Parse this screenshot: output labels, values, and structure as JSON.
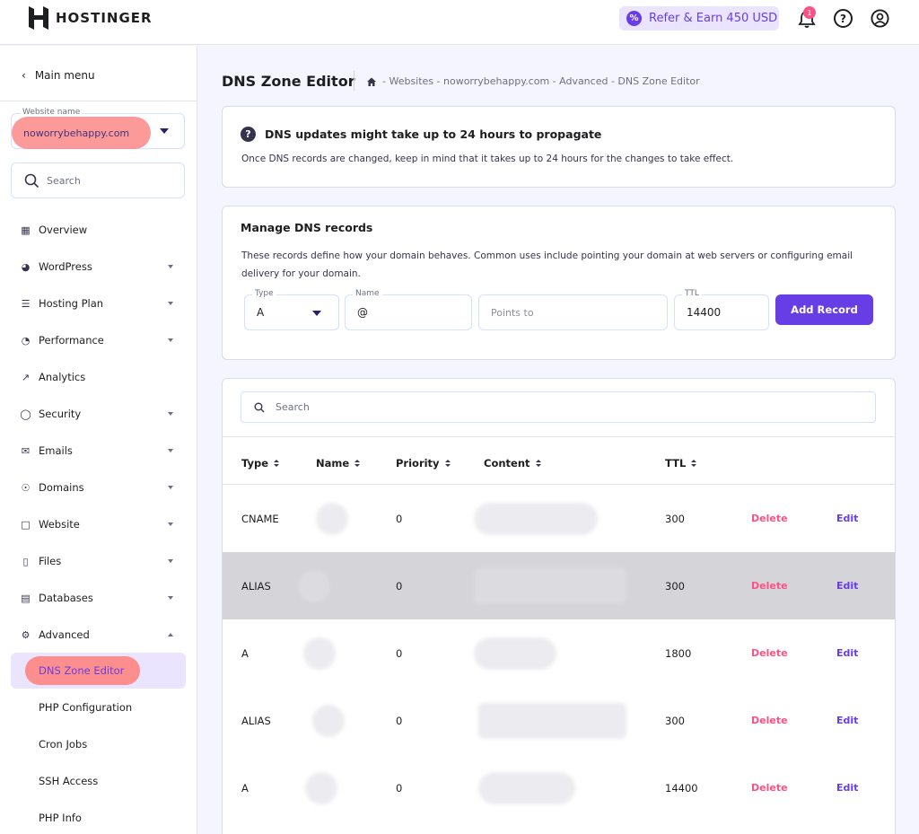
{
  "app": {
    "brand": "HOSTINGER",
    "refer_label": "Refer & Earn 450 USD",
    "notification_count": "1"
  },
  "sidebar": {
    "main_menu_label": "Main menu",
    "website_label": "Website name",
    "website_value": "noworrybehappy.com",
    "search_placeholder": "Search",
    "items": [
      {
        "label": "Overview",
        "icon": "grid-icon",
        "expandable": false
      },
      {
        "label": "WordPress",
        "icon": "wordpress-icon",
        "expandable": true
      },
      {
        "label": "Hosting Plan",
        "icon": "server-icon",
        "expandable": true
      },
      {
        "label": "Performance",
        "icon": "pie-chart-icon",
        "expandable": true
      },
      {
        "label": "Analytics",
        "icon": "trend-chart-icon",
        "expandable": false
      },
      {
        "label": "Security",
        "icon": "shield-icon",
        "expandable": true
      },
      {
        "label": "Emails",
        "icon": "mail-icon",
        "expandable": true
      },
      {
        "label": "Domains",
        "icon": "globe-icon",
        "expandable": true
      },
      {
        "label": "Website",
        "icon": "browser-window-icon",
        "expandable": true
      },
      {
        "label": "Files",
        "icon": "folder-icon",
        "expandable": true
      },
      {
        "label": "Databases",
        "icon": "database-icon",
        "expandable": true
      },
      {
        "label": "Advanced",
        "icon": "gear-icon",
        "expandable": true,
        "expanded": true
      }
    ],
    "subitems": [
      {
        "label": "DNS Zone Editor",
        "active": true
      },
      {
        "label": "PHP Configuration"
      },
      {
        "label": "Cron Jobs"
      },
      {
        "label": "SSH Access"
      },
      {
        "label": "PHP Info"
      }
    ]
  },
  "header": {
    "title": "DNS Zone Editor",
    "breadcrumb": "- Websites - noworrybehappy.com - Advanced - DNS Zone Editor"
  },
  "info_card": {
    "title": "DNS updates might take up to 24 hours to propagate",
    "description": "Once DNS records are changed, keep in mind that it takes up to 24 hours for the changes to take effect."
  },
  "manage": {
    "title": "Manage DNS records",
    "description": "These records define how your domain behaves. Common uses include pointing your domain at web servers or configuring email delivery for your domain.",
    "type_label": "Type",
    "type_value": "A",
    "name_label": "Name",
    "name_value": "@",
    "points_placeholder": "Points to",
    "ttl_label": "TTL",
    "ttl_value": "14400",
    "add_button": "Add Record"
  },
  "records": {
    "search_placeholder": "Search",
    "columns": [
      "Type",
      "Name",
      "Priority",
      "Content",
      "TTL"
    ],
    "delete_label": "Delete",
    "edit_label": "Edit",
    "rows": [
      {
        "type": "CNAME",
        "priority": "0",
        "ttl": "300"
      },
      {
        "type": "ALIAS",
        "priority": "0",
        "ttl": "300"
      },
      {
        "type": "A",
        "priority": "0",
        "ttl": "1800"
      },
      {
        "type": "ALIAS",
        "priority": "0",
        "ttl": "300"
      },
      {
        "type": "A",
        "priority": "0",
        "ttl": "14400"
      }
    ]
  },
  "colors": {
    "accent": "#673de6",
    "danger": "#fc5185",
    "highlight": "#fc8e8e"
  }
}
